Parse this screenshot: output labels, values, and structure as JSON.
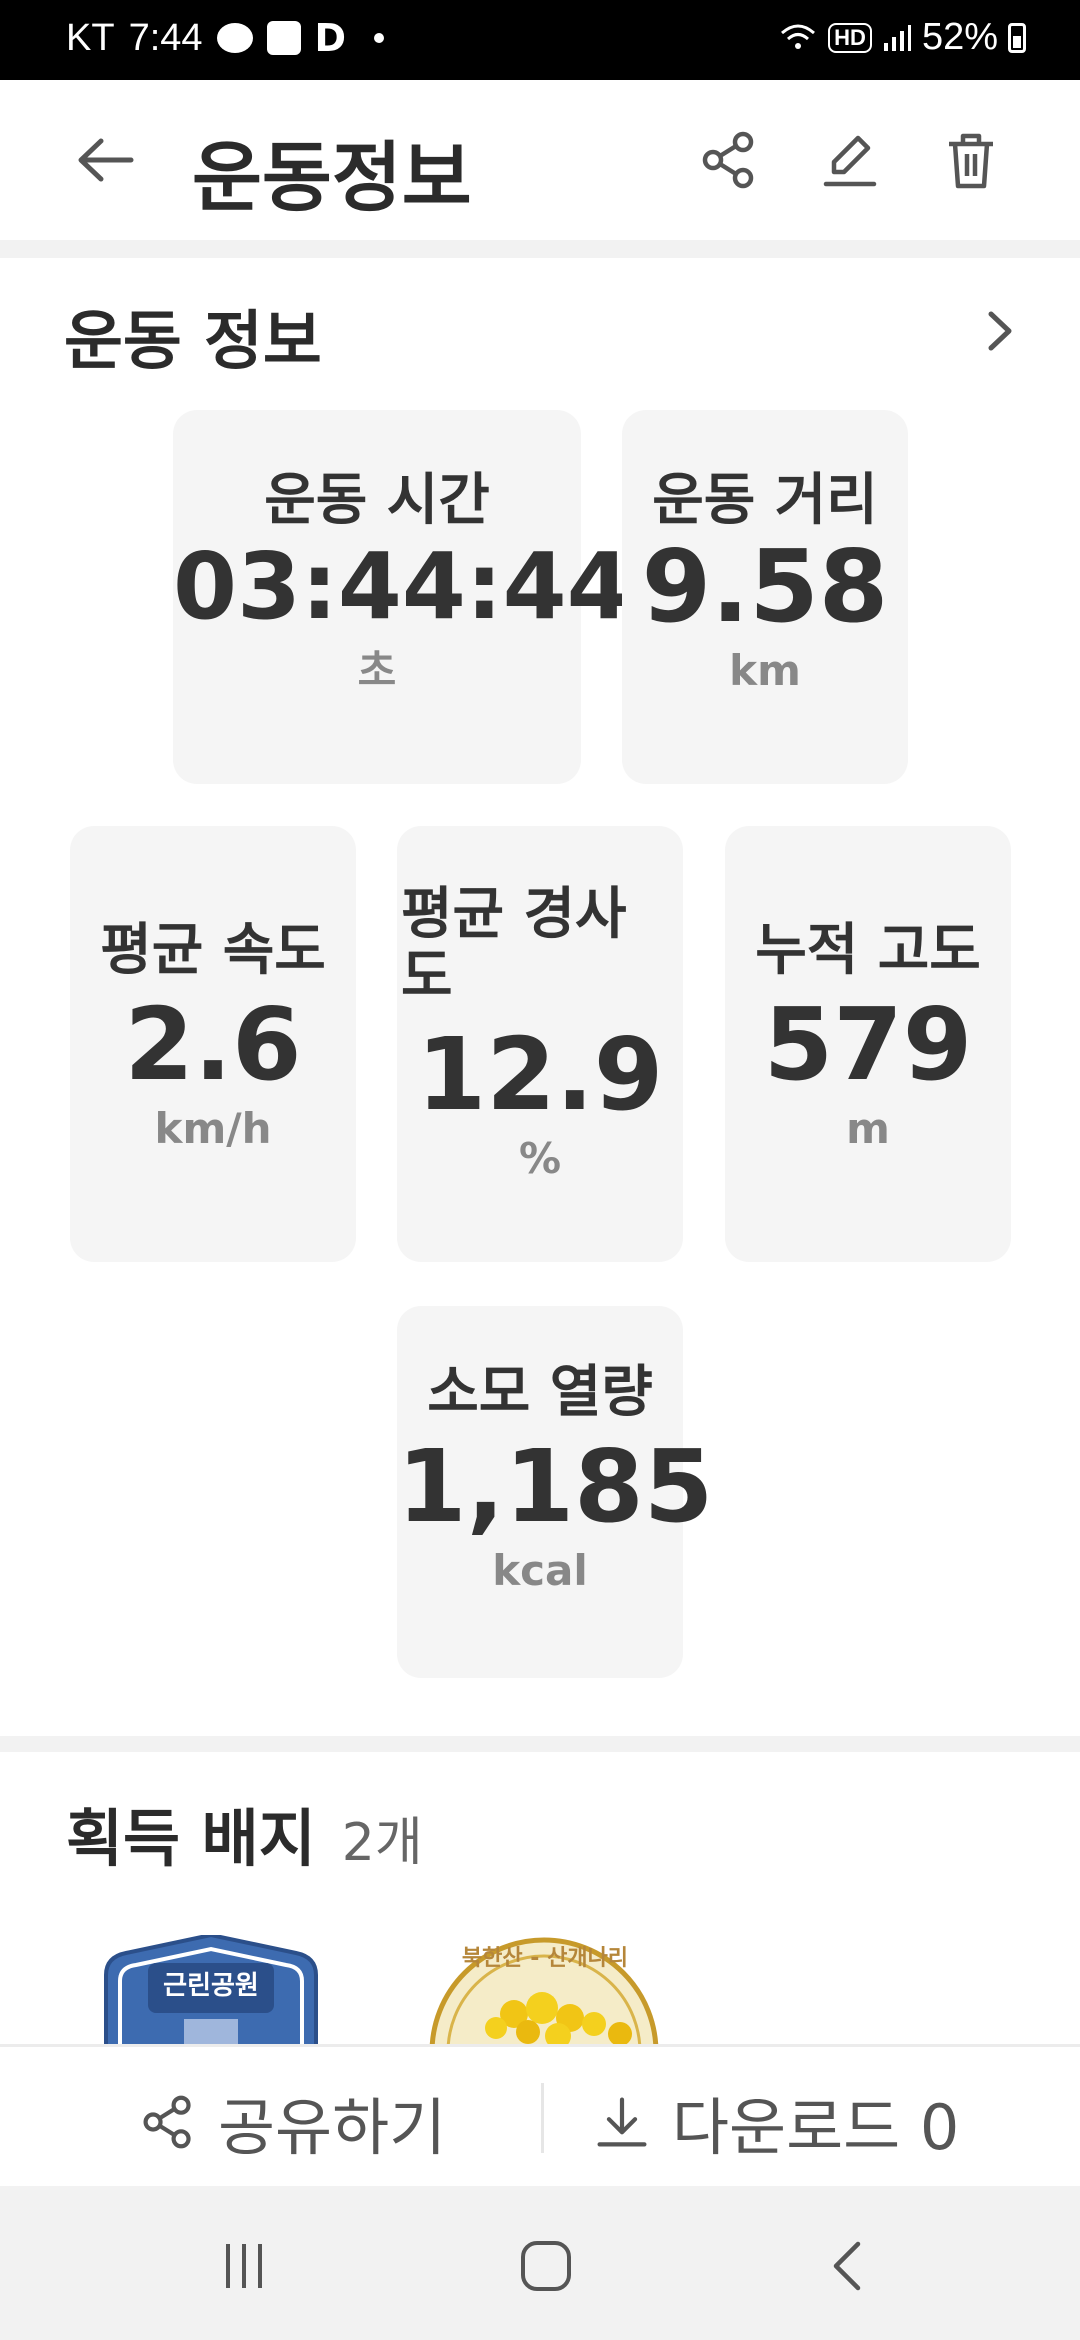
{
  "status_bar": {
    "carrier": "KT",
    "time": "7:44",
    "app_letter": "D",
    "battery_percent": "52%",
    "hd_label": "HD"
  },
  "header": {
    "title": "운동정보"
  },
  "section": {
    "title": "운동 정보"
  },
  "stats": {
    "time": {
      "label": "운동 시간",
      "value": "03:44:44",
      "unit": "초"
    },
    "distance": {
      "label": "운동 거리",
      "value": "9.58",
      "unit": "km"
    },
    "speed": {
      "label": "평균 속도",
      "value": "2.6",
      "unit": "km/h"
    },
    "slope": {
      "label": "평균 경사도",
      "value": "12.9",
      "unit": "%"
    },
    "altitude": {
      "label": "누적 고도",
      "value": "579",
      "unit": "m"
    },
    "calories": {
      "label": "소모 열량",
      "value": "1,185",
      "unit": "kcal"
    }
  },
  "badges": {
    "title": "획득 배지",
    "count": "2개",
    "items": [
      {
        "text": "근린공원"
      },
      {
        "text": "북한산 - 산개나리"
      }
    ]
  },
  "bottom": {
    "share_label": "공유하기",
    "download_label": "다운로드 0"
  },
  "icons": {
    "back": "arrow-left-icon",
    "share": "share-icon",
    "edit": "pencil-icon",
    "delete": "trash-icon",
    "chevron": "chevron-right-icon",
    "download": "download-icon"
  }
}
